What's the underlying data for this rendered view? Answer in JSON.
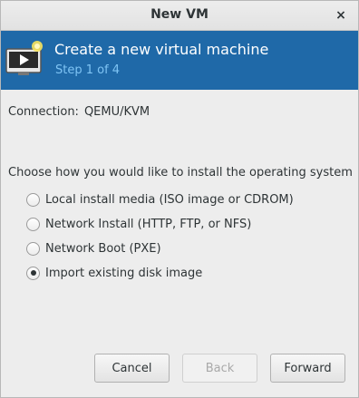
{
  "window": {
    "title": "New VM",
    "close_glyph": "×"
  },
  "banner": {
    "title": "Create a new virtual machine",
    "step": "Step 1 of 4",
    "icon": "vm-monitor-icon",
    "background_color": "#1f69a8",
    "step_color": "#7fc4f4"
  },
  "connection": {
    "label": "Connection:",
    "value": "QEMU/KVM"
  },
  "install": {
    "question": "Choose how you would like to install the operating system",
    "options": [
      {
        "label": "Local install media (ISO image or CDROM)",
        "selected": false
      },
      {
        "label": "Network Install (HTTP, FTP, or NFS)",
        "selected": false
      },
      {
        "label": "Network Boot (PXE)",
        "selected": false
      },
      {
        "label": "Import existing disk image",
        "selected": true
      }
    ]
  },
  "buttons": {
    "cancel": "Cancel",
    "back": "Back",
    "forward": "Forward"
  }
}
